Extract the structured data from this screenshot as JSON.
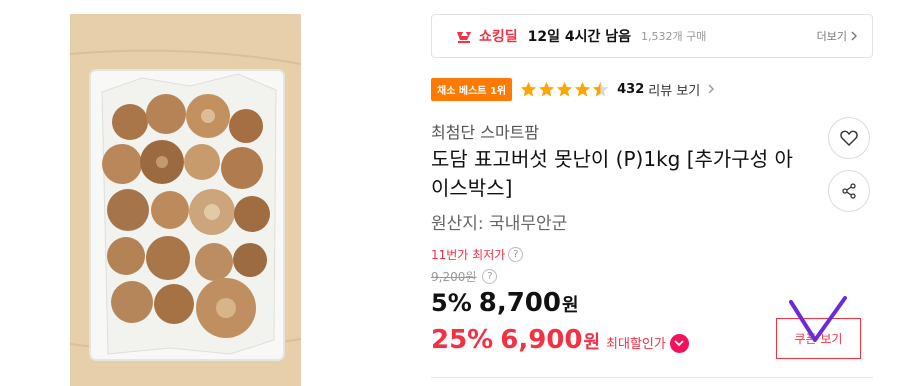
{
  "deal": {
    "name": "쇼킹딜",
    "time_left": "12일 4시간 남음",
    "purchase_count": "1,532개 구매",
    "more_label": "더보기"
  },
  "badge": {
    "label": "채소 베스트 1위"
  },
  "rating": {
    "stars": 4.5,
    "review_count": "432",
    "review_label": "리뷰 보기"
  },
  "product": {
    "seller": "최첨단 스마트팜",
    "title": "도담 표고버섯 못난이 (P)1kg [추가구성 아이스박스]",
    "origin": "원산지:  국내무안군"
  },
  "pricing": {
    "lowest_label": "11번가 최저가",
    "original_price": "9,200원",
    "discount_pct": "5%",
    "price": "8,700",
    "won": "원",
    "max_pct": "25%",
    "max_price": "6,900",
    "max_won": "원",
    "max_label": "최대할인가"
  },
  "coupon": {
    "label": "쿠폰 보기"
  },
  "colors": {
    "accent": "#f43142",
    "badge": "#ff7a00",
    "star": "#ffa500"
  },
  "icons": [
    "deal-logo-icon",
    "chevron-right-icon",
    "star-icon",
    "heart-icon",
    "share-icon",
    "question-icon",
    "chevron-down-icon",
    "check-mark-annotation"
  ]
}
